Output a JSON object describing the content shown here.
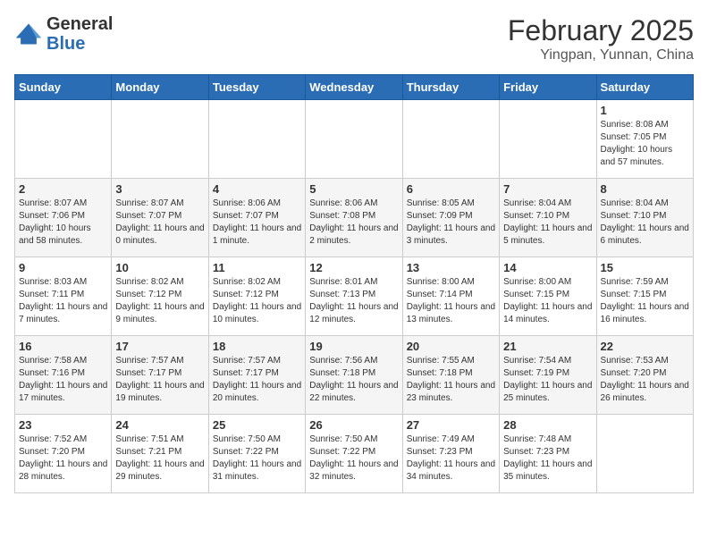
{
  "logo": {
    "line1": "General",
    "line2": "Blue"
  },
  "title": "February 2025",
  "subtitle": "Yingpan, Yunnan, China",
  "weekdays": [
    "Sunday",
    "Monday",
    "Tuesday",
    "Wednesday",
    "Thursday",
    "Friday",
    "Saturday"
  ],
  "weeks": [
    [
      {
        "day": "",
        "info": ""
      },
      {
        "day": "",
        "info": ""
      },
      {
        "day": "",
        "info": ""
      },
      {
        "day": "",
        "info": ""
      },
      {
        "day": "",
        "info": ""
      },
      {
        "day": "",
        "info": ""
      },
      {
        "day": "1",
        "info": "Sunrise: 8:08 AM\nSunset: 7:05 PM\nDaylight: 10 hours and 57 minutes."
      }
    ],
    [
      {
        "day": "2",
        "info": "Sunrise: 8:07 AM\nSunset: 7:06 PM\nDaylight: 10 hours and 58 minutes."
      },
      {
        "day": "3",
        "info": "Sunrise: 8:07 AM\nSunset: 7:07 PM\nDaylight: 11 hours and 0 minutes."
      },
      {
        "day": "4",
        "info": "Sunrise: 8:06 AM\nSunset: 7:07 PM\nDaylight: 11 hours and 1 minute."
      },
      {
        "day": "5",
        "info": "Sunrise: 8:06 AM\nSunset: 7:08 PM\nDaylight: 11 hours and 2 minutes."
      },
      {
        "day": "6",
        "info": "Sunrise: 8:05 AM\nSunset: 7:09 PM\nDaylight: 11 hours and 3 minutes."
      },
      {
        "day": "7",
        "info": "Sunrise: 8:04 AM\nSunset: 7:10 PM\nDaylight: 11 hours and 5 minutes."
      },
      {
        "day": "8",
        "info": "Sunrise: 8:04 AM\nSunset: 7:10 PM\nDaylight: 11 hours and 6 minutes."
      }
    ],
    [
      {
        "day": "9",
        "info": "Sunrise: 8:03 AM\nSunset: 7:11 PM\nDaylight: 11 hours and 7 minutes."
      },
      {
        "day": "10",
        "info": "Sunrise: 8:02 AM\nSunset: 7:12 PM\nDaylight: 11 hours and 9 minutes."
      },
      {
        "day": "11",
        "info": "Sunrise: 8:02 AM\nSunset: 7:12 PM\nDaylight: 11 hours and 10 minutes."
      },
      {
        "day": "12",
        "info": "Sunrise: 8:01 AM\nSunset: 7:13 PM\nDaylight: 11 hours and 12 minutes."
      },
      {
        "day": "13",
        "info": "Sunrise: 8:00 AM\nSunset: 7:14 PM\nDaylight: 11 hours and 13 minutes."
      },
      {
        "day": "14",
        "info": "Sunrise: 8:00 AM\nSunset: 7:15 PM\nDaylight: 11 hours and 14 minutes."
      },
      {
        "day": "15",
        "info": "Sunrise: 7:59 AM\nSunset: 7:15 PM\nDaylight: 11 hours and 16 minutes."
      }
    ],
    [
      {
        "day": "16",
        "info": "Sunrise: 7:58 AM\nSunset: 7:16 PM\nDaylight: 11 hours and 17 minutes."
      },
      {
        "day": "17",
        "info": "Sunrise: 7:57 AM\nSunset: 7:17 PM\nDaylight: 11 hours and 19 minutes."
      },
      {
        "day": "18",
        "info": "Sunrise: 7:57 AM\nSunset: 7:17 PM\nDaylight: 11 hours and 20 minutes."
      },
      {
        "day": "19",
        "info": "Sunrise: 7:56 AM\nSunset: 7:18 PM\nDaylight: 11 hours and 22 minutes."
      },
      {
        "day": "20",
        "info": "Sunrise: 7:55 AM\nSunset: 7:18 PM\nDaylight: 11 hours and 23 minutes."
      },
      {
        "day": "21",
        "info": "Sunrise: 7:54 AM\nSunset: 7:19 PM\nDaylight: 11 hours and 25 minutes."
      },
      {
        "day": "22",
        "info": "Sunrise: 7:53 AM\nSunset: 7:20 PM\nDaylight: 11 hours and 26 minutes."
      }
    ],
    [
      {
        "day": "23",
        "info": "Sunrise: 7:52 AM\nSunset: 7:20 PM\nDaylight: 11 hours and 28 minutes."
      },
      {
        "day": "24",
        "info": "Sunrise: 7:51 AM\nSunset: 7:21 PM\nDaylight: 11 hours and 29 minutes."
      },
      {
        "day": "25",
        "info": "Sunrise: 7:50 AM\nSunset: 7:22 PM\nDaylight: 11 hours and 31 minutes."
      },
      {
        "day": "26",
        "info": "Sunrise: 7:50 AM\nSunset: 7:22 PM\nDaylight: 11 hours and 32 minutes."
      },
      {
        "day": "27",
        "info": "Sunrise: 7:49 AM\nSunset: 7:23 PM\nDaylight: 11 hours and 34 minutes."
      },
      {
        "day": "28",
        "info": "Sunrise: 7:48 AM\nSunset: 7:23 PM\nDaylight: 11 hours and 35 minutes."
      },
      {
        "day": "",
        "info": ""
      }
    ]
  ]
}
